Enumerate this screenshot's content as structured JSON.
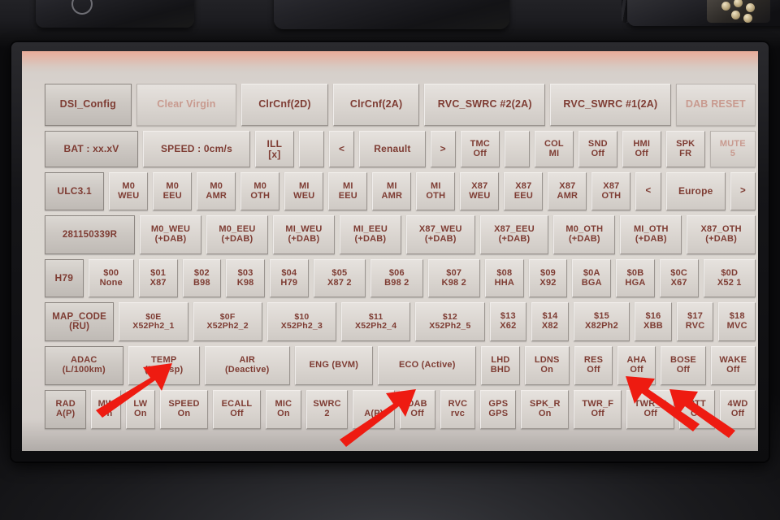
{
  "device": {
    "kind": "car-head-unit-diagnostic-screen",
    "brand_selector": "Renault"
  },
  "screen": {
    "rows": [
      {
        "name": "row-config",
        "buttons": [
          {
            "lines": [
              "DSI_Config"
            ],
            "style": "head",
            "size": "t1"
          },
          {
            "lines": [
              "Clear Virgin"
            ],
            "style": "dim",
            "size": "t1"
          },
          {
            "lines": [
              "ClrCnf(2D)"
            ],
            "style": "",
            "size": "t1"
          },
          {
            "lines": [
              "ClrCnf(2A)"
            ],
            "style": "",
            "size": "t1"
          },
          {
            "lines": [
              "RVC_SWRC #2(2A)"
            ],
            "style": "",
            "size": "t1"
          },
          {
            "lines": [
              "RVC_SWRC #1(2A)"
            ],
            "style": "",
            "size": "t1"
          },
          {
            "lines": [
              "DAB RESET"
            ],
            "style": "dim",
            "size": "t1"
          }
        ]
      },
      {
        "name": "row-status",
        "buttons": [
          {
            "lines": [
              "BAT : xx.xV"
            ],
            "style": "head",
            "size": "t2"
          },
          {
            "lines": [
              "SPEED : 0cm/s"
            ],
            "style": "",
            "size": "t2"
          },
          {
            "lines": [
              "ILL",
              "[x]"
            ],
            "style": "",
            "size": "t2"
          },
          {
            "lines": [
              ""
            ],
            "style": "",
            "size": "t4"
          },
          {
            "lines": [
              "<"
            ],
            "style": "",
            "size": "t2"
          },
          {
            "lines": [
              "Renault"
            ],
            "style": "",
            "size": "t2"
          },
          {
            "lines": [
              ">"
            ],
            "style": "",
            "size": "t2"
          },
          {
            "lines": [
              "TMC",
              "Off"
            ],
            "style": "",
            "size": "t4"
          },
          {
            "lines": [
              ""
            ],
            "style": "",
            "size": "t4"
          },
          {
            "lines": [
              "COL",
              "MI"
            ],
            "style": "",
            "size": "t4"
          },
          {
            "lines": [
              "SND",
              "Off"
            ],
            "style": "",
            "size": "t4"
          },
          {
            "lines": [
              "HMI",
              "Off"
            ],
            "style": "",
            "size": "t4"
          },
          {
            "lines": [
              "SPK",
              "FR"
            ],
            "style": "",
            "size": "t4"
          },
          {
            "lines": [
              "MUTE",
              "5"
            ],
            "style": "dim",
            "size": "t4"
          }
        ]
      },
      {
        "name": "row-ulc",
        "buttons": [
          {
            "lines": [
              "ULC3.1"
            ],
            "style": "head",
            "size": "t2"
          },
          {
            "lines": [
              "M0",
              "WEU"
            ],
            "style": "",
            "size": "t4"
          },
          {
            "lines": [
              "M0",
              "EEU"
            ],
            "style": "",
            "size": "t4"
          },
          {
            "lines": [
              "M0",
              "AMR"
            ],
            "style": "",
            "size": "t4"
          },
          {
            "lines": [
              "M0",
              "OTH"
            ],
            "style": "",
            "size": "t4"
          },
          {
            "lines": [
              "MI",
              "WEU"
            ],
            "style": "",
            "size": "t4"
          },
          {
            "lines": [
              "MI",
              "EEU"
            ],
            "style": "",
            "size": "t4"
          },
          {
            "lines": [
              "MI",
              "AMR"
            ],
            "style": "",
            "size": "t4"
          },
          {
            "lines": [
              "MI",
              "OTH"
            ],
            "style": "",
            "size": "t4"
          },
          {
            "lines": [
              "X87",
              "WEU"
            ],
            "style": "",
            "size": "t4"
          },
          {
            "lines": [
              "X87",
              "EEU"
            ],
            "style": "",
            "size": "t4"
          },
          {
            "lines": [
              "X87",
              "AMR"
            ],
            "style": "",
            "size": "t4"
          },
          {
            "lines": [
              "X87",
              "OTH"
            ],
            "style": "",
            "size": "t4"
          },
          {
            "lines": [
              "<"
            ],
            "style": "",
            "size": "t3"
          },
          {
            "lines": [
              "Europe"
            ],
            "style": "",
            "size": "t2"
          },
          {
            "lines": [
              ">"
            ],
            "style": "",
            "size": "t3"
          }
        ]
      },
      {
        "name": "row-dab",
        "buttons": [
          {
            "lines": [
              "281150339R"
            ],
            "style": "head",
            "size": "t3"
          },
          {
            "lines": [
              "M0_WEU",
              "(+DAB)"
            ],
            "style": "",
            "size": "t4"
          },
          {
            "lines": [
              "M0_EEU",
              "(+DAB)"
            ],
            "style": "",
            "size": "t4"
          },
          {
            "lines": [
              "MI_WEU",
              "(+DAB)"
            ],
            "style": "",
            "size": "t4"
          },
          {
            "lines": [
              "MI_EEU",
              "(+DAB)"
            ],
            "style": "",
            "size": "t4"
          },
          {
            "lines": [
              "X87_WEU",
              "(+DAB)"
            ],
            "style": "",
            "size": "t4"
          },
          {
            "lines": [
              "X87_EEU",
              "(+DAB)"
            ],
            "style": "",
            "size": "t4"
          },
          {
            "lines": [
              "M0_OTH",
              "(+DAB)"
            ],
            "style": "",
            "size": "t4"
          },
          {
            "lines": [
              "MI_OTH",
              "(+DAB)"
            ],
            "style": "",
            "size": "t4"
          },
          {
            "lines": [
              "X87_OTH",
              "(+DAB)"
            ],
            "style": "",
            "size": "t4"
          }
        ]
      },
      {
        "name": "row-h79",
        "buttons": [
          {
            "lines": [
              "H79"
            ],
            "style": "head",
            "size": "t2"
          },
          {
            "lines": [
              "$00",
              "None"
            ],
            "style": "",
            "size": "t4"
          },
          {
            "lines": [
              "$01",
              "X87"
            ],
            "style": "",
            "size": "t4"
          },
          {
            "lines": [
              "$02",
              "B98"
            ],
            "style": "",
            "size": "t4"
          },
          {
            "lines": [
              "$03",
              "K98"
            ],
            "style": "",
            "size": "t4"
          },
          {
            "lines": [
              "$04",
              "H79"
            ],
            "style": "",
            "size": "t4"
          },
          {
            "lines": [
              "$05",
              "X87 2"
            ],
            "style": "",
            "size": "t4"
          },
          {
            "lines": [
              "$06",
              "B98 2"
            ],
            "style": "",
            "size": "t4"
          },
          {
            "lines": [
              "$07",
              "K98 2"
            ],
            "style": "",
            "size": "t4"
          },
          {
            "lines": [
              "$08",
              "HHA"
            ],
            "style": "",
            "size": "t4"
          },
          {
            "lines": [
              "$09",
              "X92"
            ],
            "style": "",
            "size": "t4"
          },
          {
            "lines": [
              "$0A",
              "BGA"
            ],
            "style": "",
            "size": "t4"
          },
          {
            "lines": [
              "$0B",
              "HGA"
            ],
            "style": "",
            "size": "t4"
          },
          {
            "lines": [
              "$0C",
              "X67"
            ],
            "style": "",
            "size": "t4"
          },
          {
            "lines": [
              "$0D",
              "X52 1"
            ],
            "style": "",
            "size": "t4"
          }
        ]
      },
      {
        "name": "row-mapcode",
        "buttons": [
          {
            "lines": [
              "MAP_CODE",
              "(RU)"
            ],
            "style": "head",
            "size": "t3"
          },
          {
            "lines": [
              "$0E",
              "X52Ph2_1"
            ],
            "style": "",
            "size": "t5"
          },
          {
            "lines": [
              "$0F",
              "X52Ph2_2"
            ],
            "style": "",
            "size": "t5"
          },
          {
            "lines": [
              "$10",
              "X52Ph2_3"
            ],
            "style": "",
            "size": "t5"
          },
          {
            "lines": [
              "$11",
              "X52Ph2_4"
            ],
            "style": "",
            "size": "t5"
          },
          {
            "lines": [
              "$12",
              "X52Ph2_5"
            ],
            "style": "",
            "size": "t5"
          },
          {
            "lines": [
              "$13",
              "X62"
            ],
            "style": "",
            "size": "t4"
          },
          {
            "lines": [
              "$14",
              "X82"
            ],
            "style": "",
            "size": "t4"
          },
          {
            "lines": [
              "$15",
              "X82Ph2"
            ],
            "style": "",
            "size": "t4"
          },
          {
            "lines": [
              "$16",
              "XBB"
            ],
            "style": "",
            "size": "t4"
          },
          {
            "lines": [
              "$17",
              "RVC"
            ],
            "style": "",
            "size": "t4"
          },
          {
            "lines": [
              "$18",
              "MVC"
            ],
            "style": "",
            "size": "t4"
          }
        ]
      },
      {
        "name": "row-adac",
        "buttons": [
          {
            "lines": [
              "ADAC",
              "(L/100km)"
            ],
            "style": "head",
            "size": "t4"
          },
          {
            "lines": [
              "TEMP",
              "(NoDisp)"
            ],
            "style": "",
            "size": "t4"
          },
          {
            "lines": [
              "AIR",
              "(Deactive)"
            ],
            "style": "",
            "size": "t4"
          },
          {
            "lines": [
              "ENG (BVM)"
            ],
            "style": "",
            "size": "t4"
          },
          {
            "lines": [
              "ECO (Active)"
            ],
            "style": "",
            "size": "t4"
          },
          {
            "lines": [
              "LHD",
              "BHD"
            ],
            "style": "",
            "size": "t4"
          },
          {
            "lines": [
              "LDNS",
              "On"
            ],
            "style": "",
            "size": "t4"
          },
          {
            "lines": [
              "RES",
              "Off"
            ],
            "style": "",
            "size": "t4"
          },
          {
            "lines": [
              "AHA",
              "Off"
            ],
            "style": "",
            "size": "t4"
          },
          {
            "lines": [
              "BOSE",
              "Off"
            ],
            "style": "",
            "size": "t4"
          },
          {
            "lines": [
              "WAKE",
              "Off"
            ],
            "style": "",
            "size": "t4"
          }
        ]
      },
      {
        "name": "row-rad",
        "buttons": [
          {
            "lines": [
              "RAD",
              "A(P)"
            ],
            "style": "head",
            "size": "t4"
          },
          {
            "lines": [
              "MW",
              "On"
            ],
            "style": "",
            "size": "t4"
          },
          {
            "lines": [
              "LW",
              "On"
            ],
            "style": "",
            "size": "t4"
          },
          {
            "lines": [
              "SPEED",
              "On"
            ],
            "style": "",
            "size": "t4"
          },
          {
            "lines": [
              "ECALL",
              "Off"
            ],
            "style": "",
            "size": "t4"
          },
          {
            "lines": [
              "MIC",
              "On"
            ],
            "style": "",
            "size": "t4"
          },
          {
            "lines": [
              "SWRC",
              "2"
            ],
            "style": "",
            "size": "t4"
          },
          {
            "lines": [
              "",
              "A(P)"
            ],
            "style": "",
            "size": "t4"
          },
          {
            "lines": [
              "DAB",
              "Off"
            ],
            "style": "",
            "size": "t4"
          },
          {
            "lines": [
              "RVC",
              "rvc"
            ],
            "style": "",
            "size": "t4"
          },
          {
            "lines": [
              "GPS",
              "GPS"
            ],
            "style": "",
            "size": "t4"
          },
          {
            "lines": [
              "SPK_R",
              "On"
            ],
            "style": "",
            "size": "t4"
          },
          {
            "lines": [
              "TWR_F",
              "Off"
            ],
            "style": "",
            "size": "t4"
          },
          {
            "lines": [
              "TWR_R",
              "Off"
            ],
            "style": "",
            "size": "t4"
          },
          {
            "lines": [
              "PTT",
              "Off"
            ],
            "style": "",
            "size": "t4"
          },
          {
            "lines": [
              "4WD",
              "Off"
            ],
            "style": "",
            "size": "t4"
          }
        ]
      }
    ]
  },
  "annotations": {
    "color": "#ee1b11",
    "arrows": [
      {
        "name": "arrow-temp",
        "points_to": "TEMP (NoDisp)"
      },
      {
        "name": "arrow-eco",
        "points_to": "ECO (Active)"
      },
      {
        "name": "arrow-aha",
        "points_to": "AHA Off"
      },
      {
        "name": "arrow-4wd",
        "points_to": "4WD Off"
      }
    ]
  },
  "colors": {
    "screen_bg": "#dcd7d2",
    "button_face": "#dcd7d2",
    "text": "#7e3c33",
    "text_dim": "#c89a8f",
    "bezel": "#15151a",
    "arrow": "#ee1b11"
  }
}
